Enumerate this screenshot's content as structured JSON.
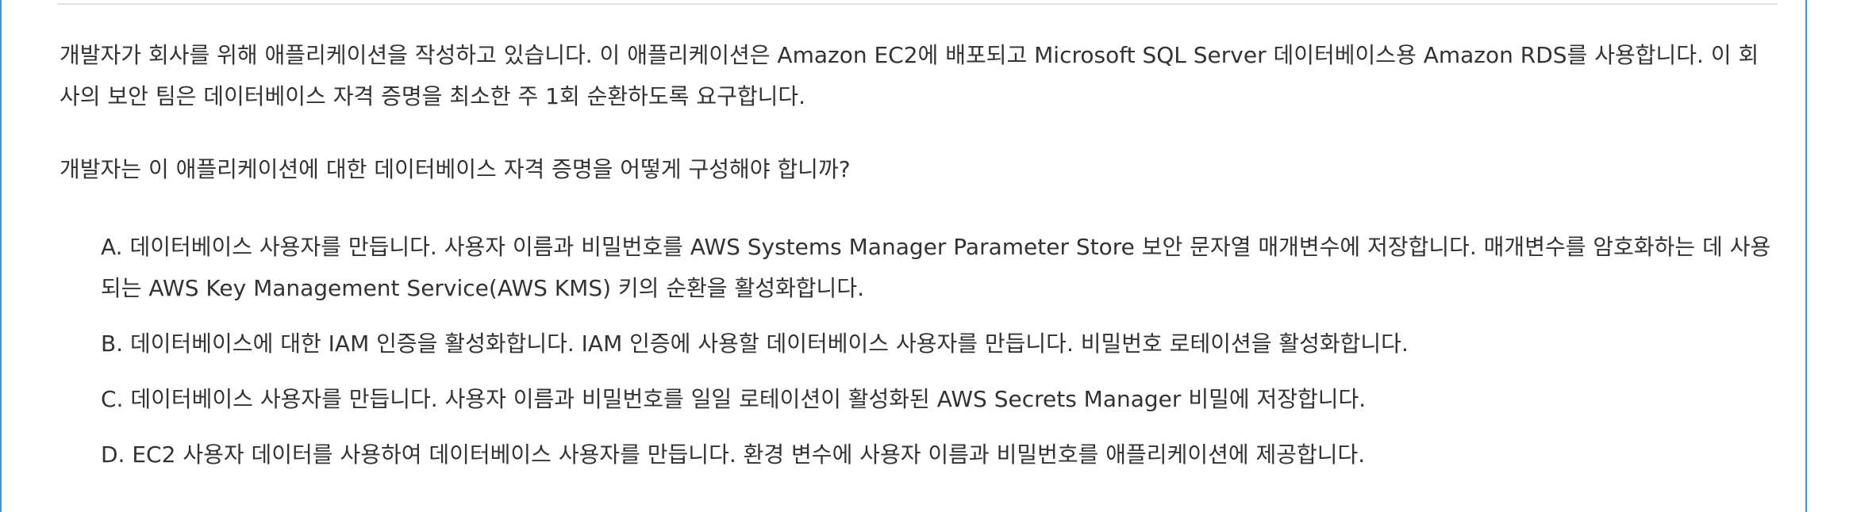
{
  "question": {
    "text": "개발자가 회사를 위해 애플리케이션을 작성하고 있습니다. 이 애플리케이션은 Amazon EC2에 배포되고 Microsoft SQL Server 데이터베이스용 Amazon RDS를 사용합니다. 이 회사의 보안 팀은 데이터베이스 자격 증명을 최소한 주 1회 순환하도록 요구합니다.",
    "prompt": "개발자는 이 애플리케이션에 대한 데이터베이스 자격 증명을 어떻게 구성해야 합니까?"
  },
  "options": [
    {
      "text": "A. 데이터베이스 사용자를 만듭니다. 사용자 이름과 비밀번호를 AWS Systems Manager Parameter Store 보안 문자열 매개변수에 저장합니다. 매개변수를 암호화하는 데 사용되는 AWS Key Management Service(AWS KMS) 키의 순환을 활성화합니다."
    },
    {
      "text": "B. 데이터베이스에 대한 IAM 인증을 활성화합니다. IAM 인증에 사용할 데이터베이스 사용자를 만듭니다. 비밀번호 로테이션을 활성화합니다."
    },
    {
      "text": "C. 데이터베이스 사용자를 만듭니다. 사용자 이름과 비밀번호를 일일 로테이션이 활성화된 AWS Secrets Manager 비밀에 저장합니다."
    },
    {
      "text": "D. EC2 사용자 데이터를 사용하여 데이터베이스 사용자를 만듭니다. 환경 변수에 사용자 이름과 비밀번호를 애플리케이션에 제공합니다."
    }
  ],
  "colors": {
    "accent_border": "#4a90d9",
    "divider": "#e2e2e2",
    "text": "#333333"
  }
}
